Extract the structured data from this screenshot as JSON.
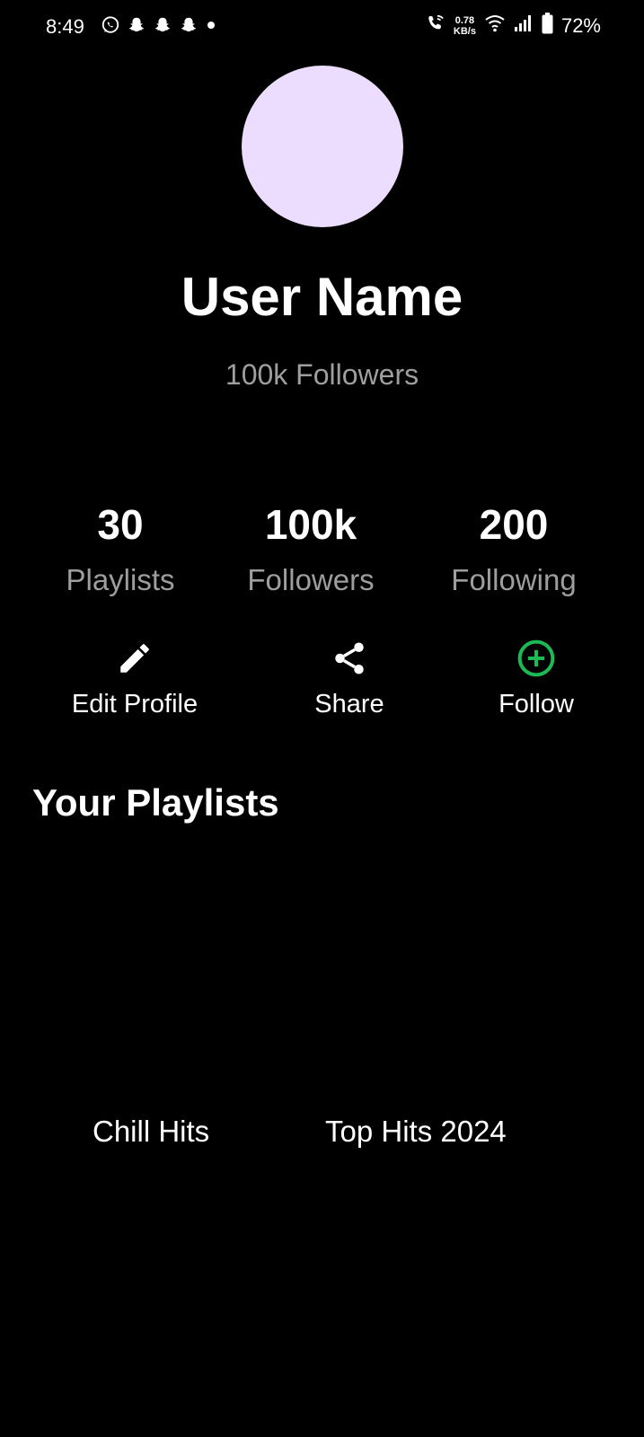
{
  "status_bar": {
    "time": "8:49",
    "notification_icons": [
      "whatsapp-icon",
      "snapchat-icon",
      "snapchat-icon",
      "snapchat-icon",
      "dot-icon"
    ],
    "net_speed_value": "0.78",
    "net_speed_unit": "KB/s",
    "battery_percent": "72%"
  },
  "profile": {
    "avatar_color": "#ecdcfd",
    "name": "User Name",
    "followers_subtitle": "100k Followers"
  },
  "stats": {
    "playlists": {
      "value": "30",
      "label": "Playlists"
    },
    "followers": {
      "value": "100k",
      "label": "Followers"
    },
    "following": {
      "value": "200",
      "label": "Following"
    }
  },
  "actions": {
    "edit_profile": {
      "label": "Edit Profile",
      "icon": "pencil-icon"
    },
    "share": {
      "label": "Share",
      "icon": "share-icon"
    },
    "follow": {
      "label": "Follow",
      "icon": "add-circle-icon",
      "icon_color": "#1db954"
    }
  },
  "playlists_section": {
    "title": "Your Playlists",
    "items": [
      {
        "label": "Chill Hits"
      },
      {
        "label": "Top Hits 2024"
      }
    ]
  },
  "colors": {
    "background": "#000000",
    "primary_text": "#ffffff",
    "secondary_text": "#9e9e9e",
    "accent_green": "#1db954"
  }
}
